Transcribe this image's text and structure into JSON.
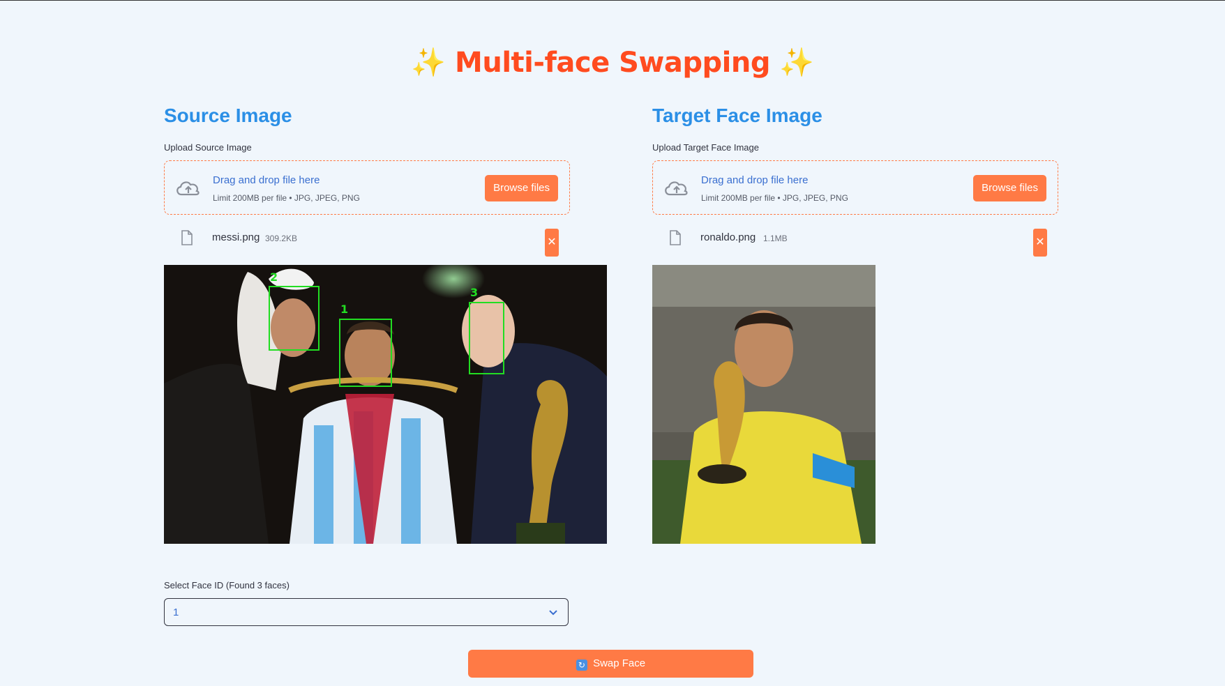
{
  "title": {
    "sparkle": "✨",
    "text": "Multi-face Swapping"
  },
  "source": {
    "heading": "Source Image",
    "upload_label": "Upload Source Image",
    "dropzone_title": "Drag and drop file here",
    "dropzone_sub": "Limit 200MB per file • JPG, JPEG, PNG",
    "browse_label": "Browse files",
    "file_name": "messi.png",
    "file_size": "309.2KB",
    "faces": [
      {
        "id": "1"
      },
      {
        "id": "2"
      },
      {
        "id": "3"
      }
    ]
  },
  "target": {
    "heading": "Target Face Image",
    "upload_label": "Upload Target Face Image",
    "dropzone_title": "Drag and drop file here",
    "dropzone_sub": "Limit 200MB per file • JPG, JPEG, PNG",
    "browse_label": "Browse files",
    "file_name": "ronaldo.png",
    "file_size": "1.1MB"
  },
  "face_select": {
    "label": "Select Face ID (Found 3 faces)",
    "value": "1"
  },
  "swap_button": {
    "label": "Swap Face"
  },
  "remove_symbol": "✕",
  "colors": {
    "accent": "#ff7a45",
    "title": "#ff4b1f",
    "heading": "#2b8fe6",
    "background": "#f0f6fc",
    "face_box": "#22dd22"
  }
}
